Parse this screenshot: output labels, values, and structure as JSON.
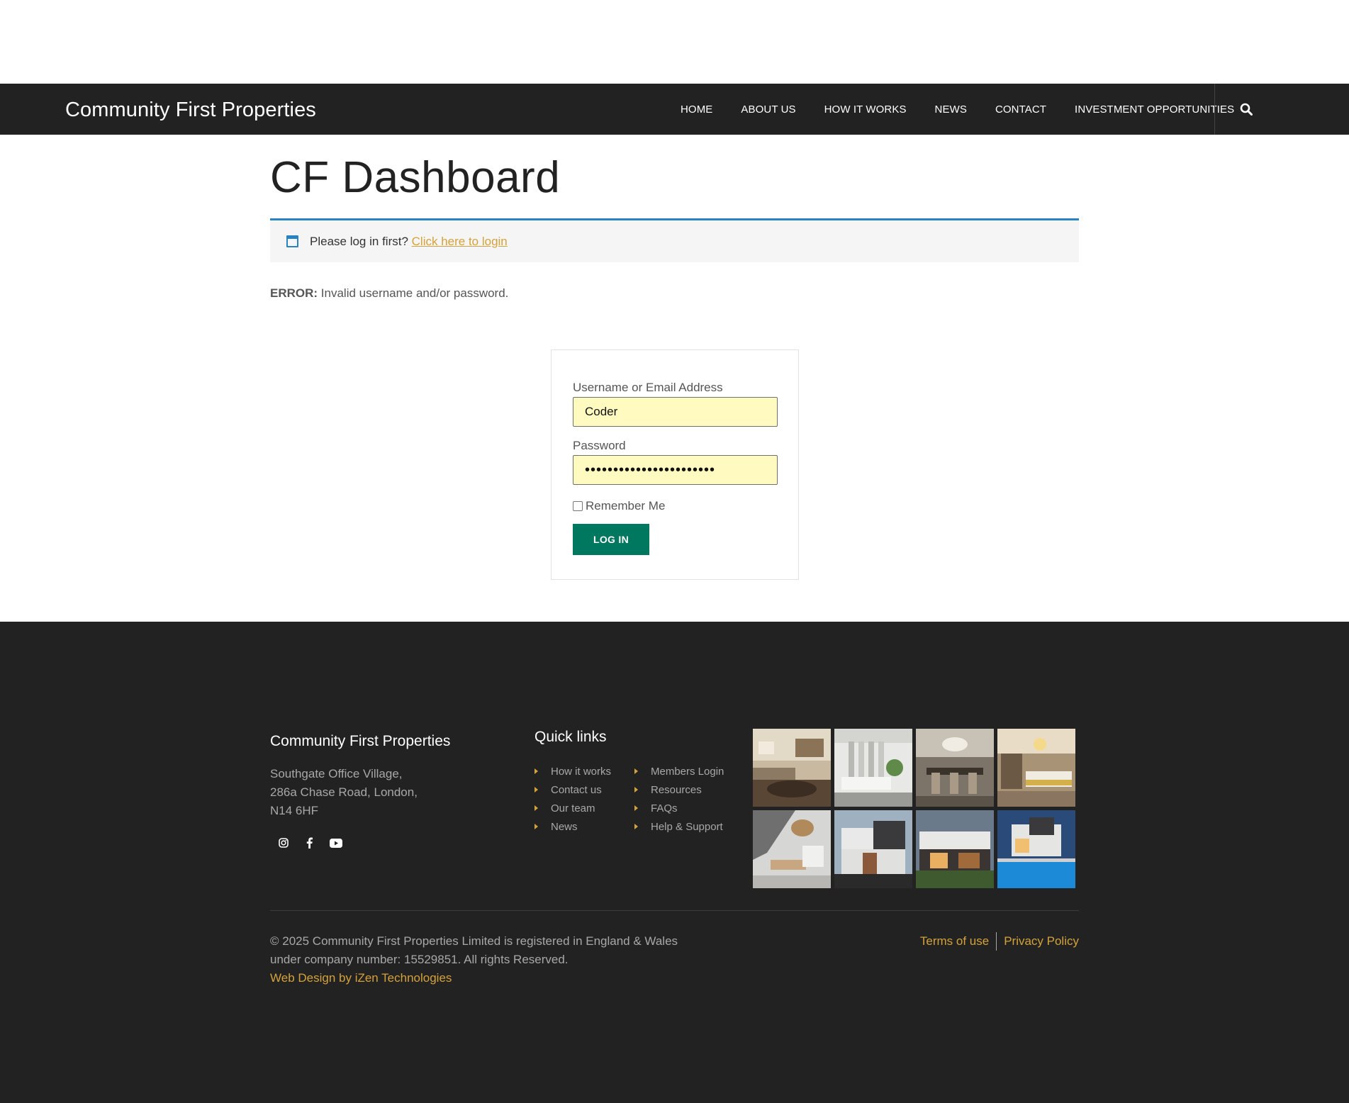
{
  "header": {
    "site_title": "Community First Properties",
    "nav": [
      "HOME",
      "ABOUT US",
      "HOW IT WORKS",
      "NEWS",
      "CONTACT",
      "INVESTMENT OPPORTUNITIES"
    ],
    "search_icon": "search-icon"
  },
  "main": {
    "title": "CF Dashboard",
    "notice": {
      "icon": "calendar-icon",
      "text": "Please log in first?",
      "link": "Click here to login"
    },
    "error": {
      "label": "ERROR:",
      "message": "Invalid username and/or password."
    },
    "login": {
      "username_label": "Username or Email Address",
      "username_value": "Coder",
      "password_label": "Password",
      "password_mask": "•••••••••••••••••••••••",
      "remember_label": "Remember Me",
      "remember_checked": false,
      "button": "LOG IN"
    }
  },
  "footer": {
    "brand": "Community First Properties",
    "address": [
      "Southgate Office Village,",
      "286a Chase Road, London,",
      "N14 6HF"
    ],
    "social": [
      "instagram-icon",
      "facebook-icon",
      "youtube-icon"
    ],
    "quick_links_title": "Quick links",
    "quick_links_col1": [
      "How it works",
      "Contact us",
      "Our team",
      "News"
    ],
    "quick_links_col2": [
      "Members Login",
      "Resources",
      "FAQs",
      "Help & Support"
    ],
    "copyright_line1": "© 2025 Community First Properties Limited is registered in England & Wales",
    "copyright_line2": "under company number: 15529851. All rights Reserved.",
    "credit": "Web Design by iZen Technologies",
    "terms": "Terms of use",
    "privacy": "Privacy Policy"
  },
  "colors": {
    "header_bg": "#222222",
    "accent_gold": "#d4a23b",
    "notice_blue": "#2a82c3",
    "button_green": "#00775f",
    "autofill_yellow": "#fffbc0"
  }
}
